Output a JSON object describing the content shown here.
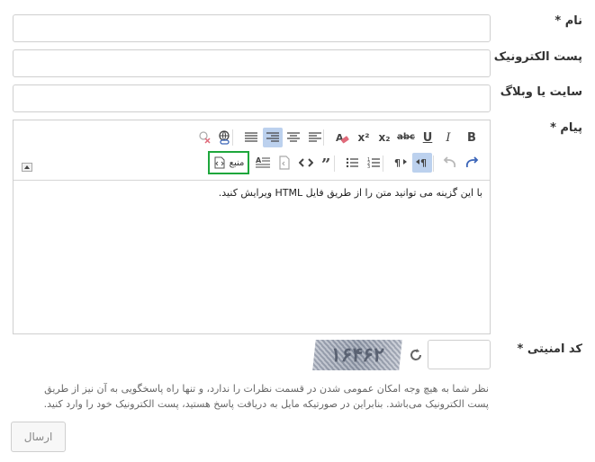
{
  "form": {
    "name_label": "نام *",
    "email_label": "پست الکترونیک",
    "website_label": "سایت یا وبلاگ",
    "message_label": "پیام *",
    "captcha_label": "کد امنیتی *",
    "captcha_text": "١۶۴۶٢",
    "note": "نظر شما به هیچ وجه امکان عمومی شدن در قسمت نظرات را ندارد، و تنها راه پاسخگویی به آن نیز از طریق پست الکترونیک می‌باشد. بنابراین در صورتیکه مایل به دریافت پاسخ هستید، پست الکترونیک خود را وارد کنید.",
    "submit_label": "ارسال"
  },
  "editor": {
    "content": "با این گزینه می توانید متن را از طریق فایل HTML ویرایش کنید.",
    "source_label": "منبع",
    "toolbar_row1": [
      "B",
      "I",
      "U",
      "abc",
      "x₂",
      "x²"
    ]
  }
}
